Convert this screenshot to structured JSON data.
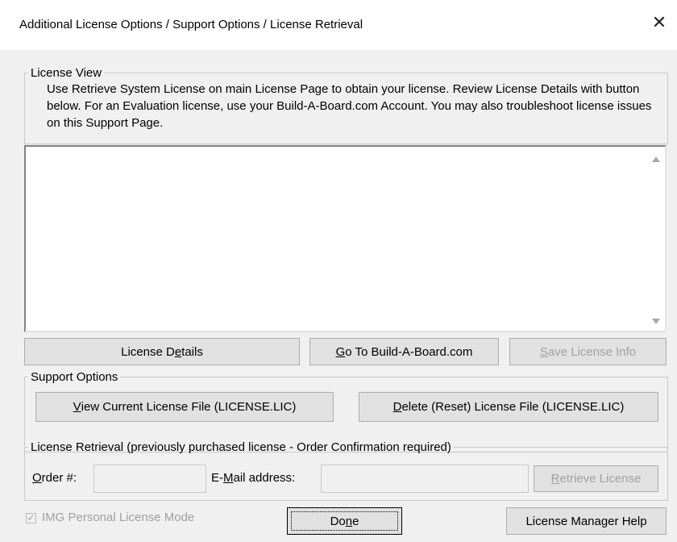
{
  "window": {
    "title": "Additional License Options / Support Options / License Retrieval",
    "close_glyph": "✕"
  },
  "license_view": {
    "legend": "License View",
    "description": "Use Retrieve System License on main License Page to obtain your license.  Review License Details with button below.  For an Evaluation license, use your Build-A-Board.com Account.  You may also troubleshoot license issues on this Support Page.",
    "text_area_value": "",
    "buttons": {
      "license_details": {
        "pre": "License D",
        "u": "e",
        "post": "tails"
      },
      "go_to": {
        "pre": "",
        "u": "G",
        "post": "o To Build-A-Board.com"
      },
      "save_info": {
        "pre": "",
        "u": "S",
        "post": "ave License Info"
      }
    }
  },
  "support_options": {
    "legend": "Support Options",
    "view_file": {
      "pre": "",
      "u": "V",
      "post": "iew Current License File (LICENSE.LIC)"
    },
    "delete_file": {
      "pre": "",
      "u": "D",
      "post": "elete (Reset) License File (LICENSE.LIC)"
    }
  },
  "license_retrieval": {
    "legend": "License Retrieval (previously purchased license - Order Confirmation required)",
    "order_label": {
      "pre": "",
      "u": "O",
      "post": "rder #:"
    },
    "order_value": "",
    "email_label": {
      "pre": "E-",
      "u": "M",
      "post": "ail address:"
    },
    "email_value": "",
    "retrieve": {
      "pre": "",
      "u": "R",
      "post": "etrieve License"
    }
  },
  "footer": {
    "img_mode_label": "IMG Personal License Mode",
    "img_mode_checked": true,
    "done": {
      "pre": "Do",
      "u": "n",
      "post": "e"
    },
    "help": "License Manager Help"
  }
}
